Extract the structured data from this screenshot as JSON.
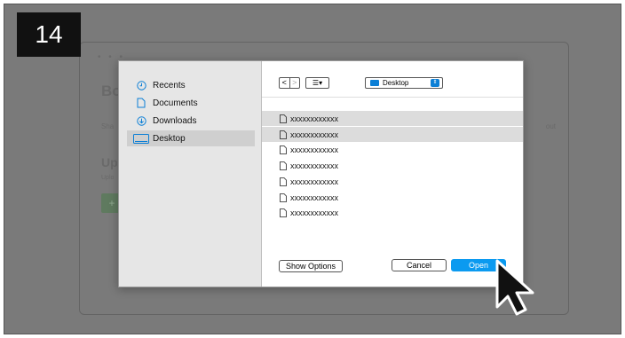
{
  "step_number": "14",
  "background_window": {
    "dots": "• • •",
    "heading": "Bo",
    "text_left": "Sha",
    "text_right": "out",
    "subheading": "Upl",
    "subtext": "Uplo",
    "button_glyph": "+"
  },
  "dialog": {
    "sidebar": {
      "items": [
        {
          "label": "Recents",
          "icon": "clock-icon"
        },
        {
          "label": "Documents",
          "icon": "document-icon"
        },
        {
          "label": "Downloads",
          "icon": "download-icon"
        },
        {
          "label": "Desktop",
          "icon": "desktop-icon",
          "selected": true
        }
      ]
    },
    "toolbar": {
      "back_glyph": "<",
      "forward_glyph": ">",
      "view_glyph": "☰▾",
      "location": "Desktop",
      "location_glyph": "⇕"
    },
    "files": [
      {
        "name": "xxxxxxxxxxxx",
        "selected": true
      },
      {
        "name": "xxxxxxxxxxxx",
        "selected": true
      },
      {
        "name": "xxxxxxxxxxxx",
        "selected": false
      },
      {
        "name": "xxxxxxxxxxxx",
        "selected": false
      },
      {
        "name": "xxxxxxxxxxxx",
        "selected": false
      },
      {
        "name": "xxxxxxxxxxxx",
        "selected": false
      },
      {
        "name": "xxxxxxxxxxxx",
        "selected": false
      }
    ],
    "buttons": {
      "show_options": "Show Options",
      "cancel": "Cancel",
      "open": "Open"
    }
  },
  "colors": {
    "accent": "#0b9af0",
    "overlay": "#7a7a7a"
  }
}
